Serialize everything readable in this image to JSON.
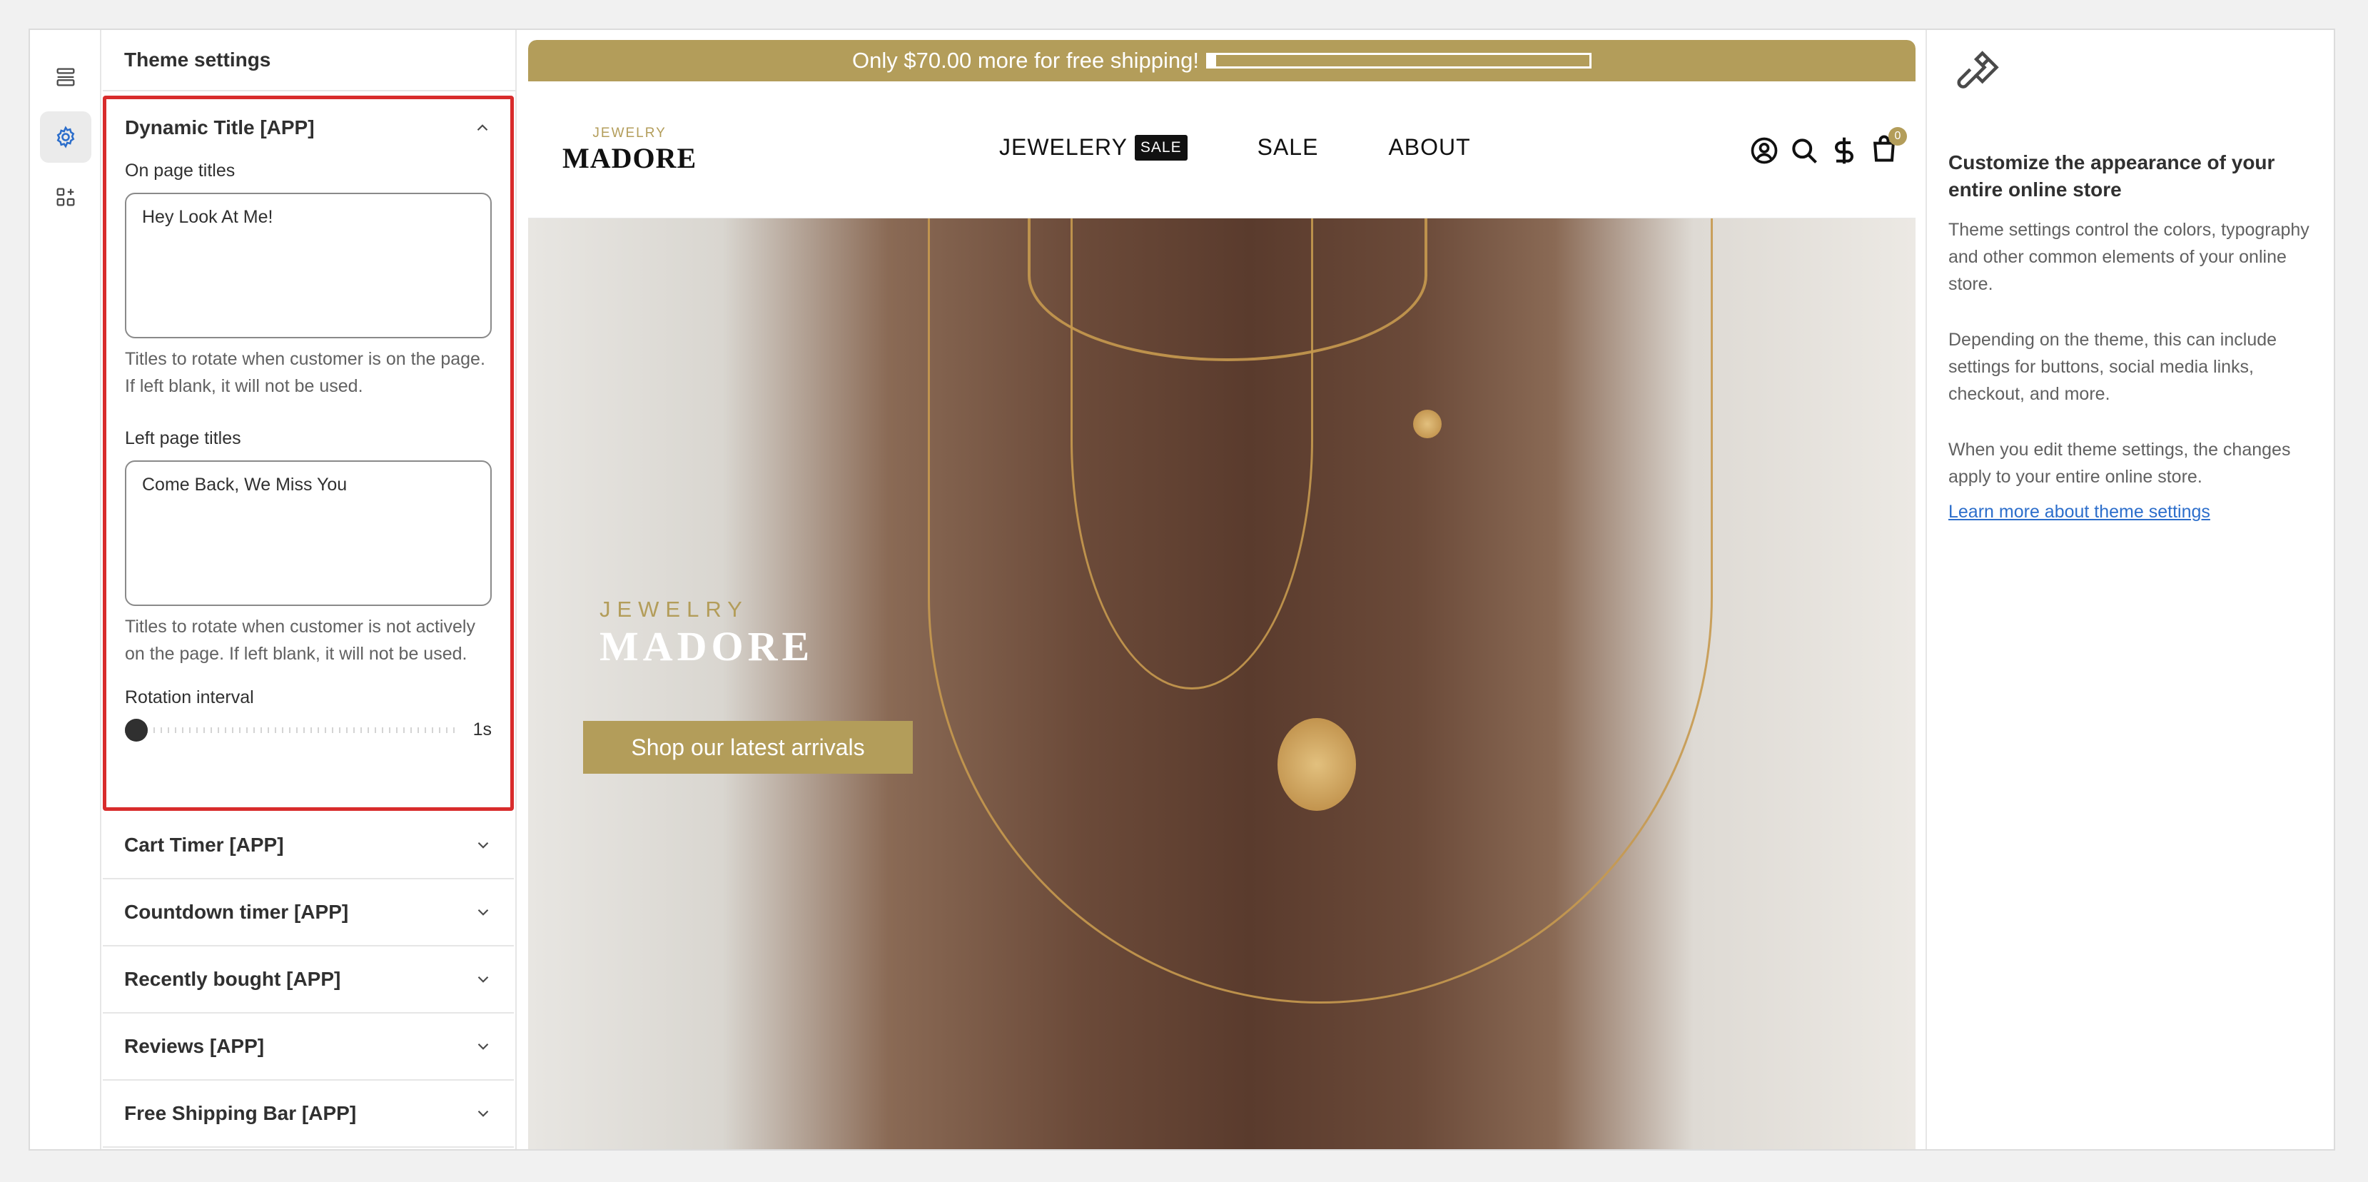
{
  "rail": {
    "items": [
      {
        "icon": "sections-icon"
      },
      {
        "icon": "gear-icon",
        "active": true
      },
      {
        "icon": "apps-icon"
      }
    ]
  },
  "settings": {
    "title": "Theme settings",
    "expanded_section": {
      "title": "Dynamic Title [APP]",
      "on_page_label": "On page titles",
      "on_page_value": "Hey Look At Me!",
      "on_page_help": "Titles to rotate when customer is on the page. If left blank, it will not be used.",
      "left_page_label": "Left page titles",
      "left_page_value": "Come Back, We Miss You",
      "left_page_help": "Titles to rotate when customer is not actively on the page. If left blank, it will not be used.",
      "interval_label": "Rotation interval",
      "interval_value": "1s",
      "interval_fraction": 0.0
    },
    "collapsed_sections": [
      "Cart Timer [APP]",
      "Countdown timer [APP]",
      "Recently bought [APP]",
      "Reviews [APP]",
      "Free Shipping Bar [APP]"
    ]
  },
  "preview": {
    "announcement": "Only $70.00 more for free shipping!",
    "shipping_progress": 0.02,
    "logo_small": "JEWELRY",
    "logo_big": "MADORE",
    "nav": [
      "JEWELERY",
      "SALE",
      "ABOUT"
    ],
    "sale_badge": "SALE",
    "cart_count": "0",
    "hero_logo_small": "JEWELRY",
    "hero_logo_big": "MADORE",
    "hero_button": "Shop our latest arrivals"
  },
  "info": {
    "title": "Customize the appearance of your entire online store",
    "p1": "Theme settings control the colors, typography and other common elements of your online store.",
    "p2": "Depending on the theme, this can include settings for buttons, social media links, checkout, and more.",
    "p3": "When you edit theme settings, the changes apply to your entire online store.",
    "link": "Learn more about theme settings"
  },
  "colors": {
    "accent_gold": "#b39d5a",
    "highlight_red": "#d82c2c",
    "link_blue": "#2c6ecb"
  }
}
